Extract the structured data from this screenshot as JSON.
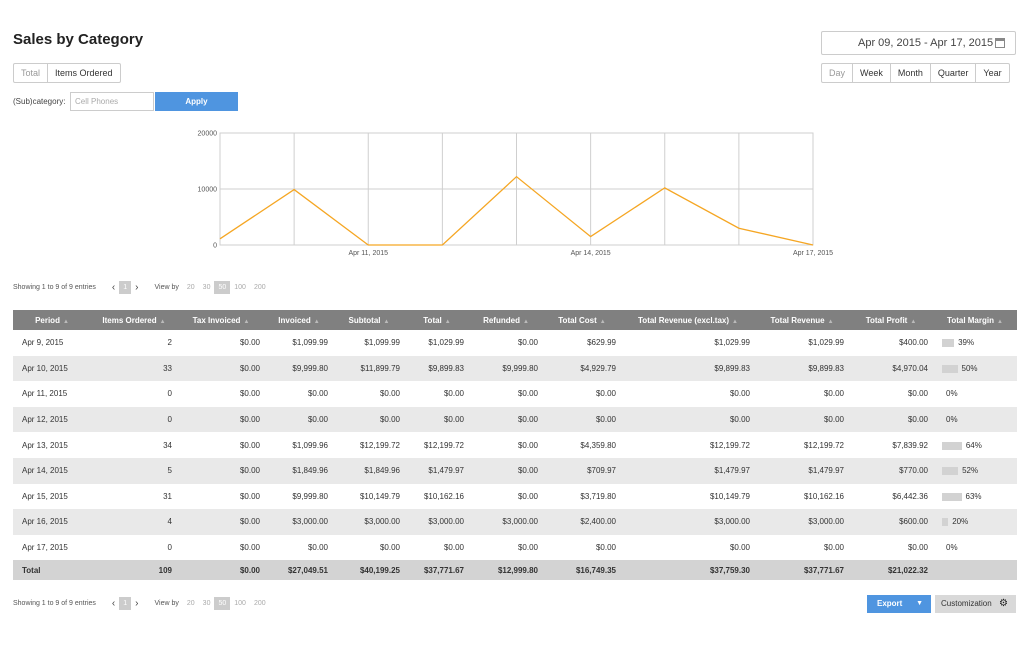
{
  "page": {
    "title": "Sales by Category"
  },
  "mode_tabs": [
    {
      "label": "Total",
      "active": false
    },
    {
      "label": "Items Ordered",
      "active": true
    }
  ],
  "date_range": {
    "value": "Apr 09, 2015 - Apr 17, 2015",
    "icon": "calendar-icon"
  },
  "period_tabs": [
    {
      "label": "Day",
      "active": true
    },
    {
      "label": "Week"
    },
    {
      "label": "Month"
    },
    {
      "label": "Quarter"
    },
    {
      "label": "Year"
    }
  ],
  "filter": {
    "label": "(Sub)category:",
    "placeholder": "Cell Phones",
    "apply_label": "Apply"
  },
  "chart_data": {
    "type": "line",
    "x": [
      "Apr 9, 2015",
      "Apr 10, 2015",
      "Apr 11, 2015",
      "Apr 12, 2015",
      "Apr 13, 2015",
      "Apr 14, 2015",
      "Apr 15, 2015",
      "Apr 16, 2015",
      "Apr 17, 2015"
    ],
    "series": [
      {
        "values": [
          2,
          33,
          0,
          0,
          34,
          5,
          31,
          4,
          0
        ],
        "color": "#f5a623"
      }
    ],
    "y_display_values": [
      1100,
      9900,
      0,
      0,
      12200,
      1500,
      10200,
      3000,
      0
    ],
    "ylim": [
      0,
      20000
    ],
    "y_ticks": [
      "0",
      "10000",
      "20000"
    ],
    "x_tick_labels": [
      {
        "index": 2,
        "label": "Apr 11, 2015"
      },
      {
        "index": 5,
        "label": "Apr 14, 2015"
      },
      {
        "index": 8,
        "label": "Apr 17, 2015"
      }
    ],
    "grid": true
  },
  "paging": {
    "info": "Showing 1 to 9 of 9 entries",
    "current_page": "1",
    "view_by_label": "View by",
    "options": [
      "20",
      "30",
      "50",
      "100",
      "200"
    ],
    "selected": "50",
    "prev_icon": "chevron-left-icon",
    "next_icon": "chevron-right-icon"
  },
  "table": {
    "columns": [
      "Period",
      "Items Ordered",
      "Tax Invoiced",
      "Invoiced",
      "Subtotal",
      "Total",
      "Refunded",
      "Total Cost",
      "Total Revenue (excl.tax)",
      "Total Revenue",
      "Total Profit",
      "Total Margin"
    ],
    "rows": [
      [
        "Apr 9, 2015",
        "2",
        "$0.00",
        "$1,099.99",
        "$1,099.99",
        "$1,029.99",
        "$0.00",
        "$629.99",
        "$1,029.99",
        "$1,029.99",
        "$400.00",
        "39%"
      ],
      [
        "Apr 10, 2015",
        "33",
        "$0.00",
        "$9,999.80",
        "$11,899.79",
        "$9,899.83",
        "$9,999.80",
        "$4,929.79",
        "$9,899.83",
        "$9,899.83",
        "$4,970.04",
        "50%"
      ],
      [
        "Apr 11, 2015",
        "0",
        "$0.00",
        "$0.00",
        "$0.00",
        "$0.00",
        "$0.00",
        "$0.00",
        "$0.00",
        "$0.00",
        "$0.00",
        "0%"
      ],
      [
        "Apr 12, 2015",
        "0",
        "$0.00",
        "$0.00",
        "$0.00",
        "$0.00",
        "$0.00",
        "$0.00",
        "$0.00",
        "$0.00",
        "$0.00",
        "0%"
      ],
      [
        "Apr 13, 2015",
        "34",
        "$0.00",
        "$1,099.96",
        "$12,199.72",
        "$12,199.72",
        "$0.00",
        "$4,359.80",
        "$12,199.72",
        "$12,199.72",
        "$7,839.92",
        "64%"
      ],
      [
        "Apr 14, 2015",
        "5",
        "$0.00",
        "$1,849.96",
        "$1,849.96",
        "$1,479.97",
        "$0.00",
        "$709.97",
        "$1,479.97",
        "$1,479.97",
        "$770.00",
        "52%"
      ],
      [
        "Apr 15, 2015",
        "31",
        "$0.00",
        "$9,999.80",
        "$10,149.79",
        "$10,162.16",
        "$0.00",
        "$3,719.80",
        "$10,149.79",
        "$10,162.16",
        "$6,442.36",
        "63%"
      ],
      [
        "Apr 16, 2015",
        "4",
        "$0.00",
        "$3,000.00",
        "$3,000.00",
        "$3,000.00",
        "$3,000.00",
        "$2,400.00",
        "$3,000.00",
        "$3,000.00",
        "$600.00",
        "20%"
      ],
      [
        "Apr 17, 2015",
        "0",
        "$0.00",
        "$0.00",
        "$0.00",
        "$0.00",
        "$0.00",
        "$0.00",
        "$0.00",
        "$0.00",
        "$0.00",
        "0%"
      ]
    ],
    "margins": [
      39,
      50,
      0,
      0,
      64,
      52,
      63,
      20,
      0
    ],
    "totals": [
      "Total",
      "109",
      "$0.00",
      "$27,049.51",
      "$40,199.25",
      "$37,771.67",
      "$12,999.80",
      "$16,749.35",
      "$37,759.30",
      "$37,771.67",
      "$21,022.32",
      ""
    ]
  },
  "actions": {
    "export_label": "Export",
    "customization_label": "Customization",
    "accent": "#4f95e0"
  }
}
